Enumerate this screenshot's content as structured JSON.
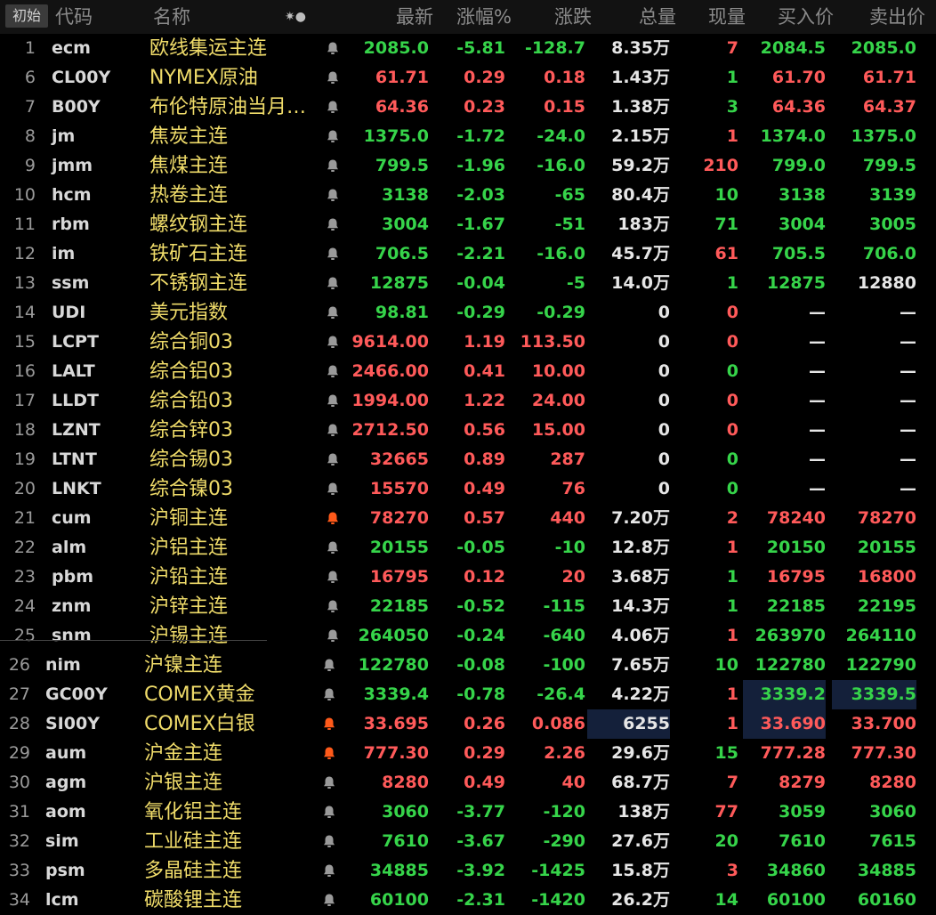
{
  "header": {
    "init_label": "初始",
    "code": "代码",
    "name": "名称",
    "settings_glyph": "✷●",
    "last": "最新",
    "pct": "涨幅%",
    "change": "涨跌",
    "volume": "总量",
    "current": "现量",
    "bid": "买入价",
    "ask": "卖出价"
  },
  "colors": {
    "up": "#ff5a5a",
    "down": "#36d44a",
    "name": "#f0dc6a",
    "bell_active": "#ff5a1a",
    "bell_inactive": "#9a9a9a",
    "highlight": "#14203a"
  },
  "rows": [
    {
      "num": "1",
      "code": "ecm",
      "name": "欧线集运主连",
      "bell": "off",
      "last": "2085.0",
      "pct": "-5.81",
      "chg": "-128.7",
      "vol": "8.35万",
      "cur": "7",
      "bid": "2084.5",
      "ask": "2085.0",
      "lc": "dn",
      "pc": "dn",
      "cc": "dn",
      "curc": "up",
      "bc": "dn",
      "ac": "dn"
    },
    {
      "num": "6",
      "code": "CL00Y",
      "name": "NYMEX原油",
      "bell": "off",
      "last": "61.71",
      "pct": "0.29",
      "chg": "0.18",
      "vol": "1.43万",
      "cur": "1",
      "bid": "61.70",
      "ask": "61.71",
      "lc": "up",
      "pc": "up",
      "cc": "up",
      "curc": "dn",
      "bc": "up",
      "ac": "up"
    },
    {
      "num": "7",
      "code": "B00Y",
      "name": "布伦特原油当月…",
      "bell": "off",
      "last": "64.36",
      "pct": "0.23",
      "chg": "0.15",
      "vol": "1.38万",
      "cur": "3",
      "bid": "64.36",
      "ask": "64.37",
      "lc": "up",
      "pc": "up",
      "cc": "up",
      "curc": "dn",
      "bc": "up",
      "ac": "up"
    },
    {
      "num": "8",
      "code": "jm",
      "name": "焦炭主连",
      "bell": "off",
      "last": "1375.0",
      "pct": "-1.72",
      "chg": "-24.0",
      "vol": "2.15万",
      "cur": "1",
      "bid": "1374.0",
      "ask": "1375.0",
      "lc": "dn",
      "pc": "dn",
      "cc": "dn",
      "curc": "up",
      "bc": "dn",
      "ac": "dn"
    },
    {
      "num": "9",
      "code": "jmm",
      "name": "焦煤主连",
      "bell": "off",
      "last": "799.5",
      "pct": "-1.96",
      "chg": "-16.0",
      "vol": "59.2万",
      "cur": "210",
      "bid": "799.0",
      "ask": "799.5",
      "lc": "dn",
      "pc": "dn",
      "cc": "dn",
      "curc": "up",
      "bc": "dn",
      "ac": "dn"
    },
    {
      "num": "10",
      "code": "hcm",
      "name": "热卷主连",
      "bell": "off",
      "last": "3138",
      "pct": "-2.03",
      "chg": "-65",
      "vol": "80.4万",
      "cur": "10",
      "bid": "3138",
      "ask": "3139",
      "lc": "dn",
      "pc": "dn",
      "cc": "dn",
      "curc": "dn",
      "bc": "dn",
      "ac": "dn"
    },
    {
      "num": "11",
      "code": "rbm",
      "name": "螺纹钢主连",
      "bell": "off",
      "last": "3004",
      "pct": "-1.67",
      "chg": "-51",
      "vol": "183万",
      "cur": "71",
      "bid": "3004",
      "ask": "3005",
      "lc": "dn",
      "pc": "dn",
      "cc": "dn",
      "curc": "dn",
      "bc": "dn",
      "ac": "dn"
    },
    {
      "num": "12",
      "code": "im",
      "name": "铁矿石主连",
      "bell": "off",
      "last": "706.5",
      "pct": "-2.21",
      "chg": "-16.0",
      "vol": "45.7万",
      "cur": "61",
      "bid": "705.5",
      "ask": "706.0",
      "lc": "dn",
      "pc": "dn",
      "cc": "dn",
      "curc": "up",
      "bc": "dn",
      "ac": "dn"
    },
    {
      "num": "13",
      "code": "ssm",
      "name": "不锈钢主连",
      "bell": "off",
      "last": "12875",
      "pct": "-0.04",
      "chg": "-5",
      "vol": "14.0万",
      "cur": "1",
      "bid": "12875",
      "ask": "12880",
      "lc": "dn",
      "pc": "dn",
      "cc": "dn",
      "curc": "dn",
      "bc": "dn",
      "ac": "nt"
    },
    {
      "num": "14",
      "code": "UDI",
      "name": "美元指数",
      "bell": "off",
      "last": "98.81",
      "pct": "-0.29",
      "chg": "-0.29",
      "vol": "0",
      "cur": "0",
      "bid": "—",
      "ask": "—",
      "lc": "dn",
      "pc": "dn",
      "cc": "dn",
      "curc": "up",
      "bc": "dash",
      "ac": "dash"
    },
    {
      "num": "15",
      "code": "LCPT",
      "name": "综合铜03",
      "bell": "off",
      "last": "9614.00",
      "pct": "1.19",
      "chg": "113.50",
      "vol": "0",
      "cur": "0",
      "bid": "—",
      "ask": "—",
      "lc": "up",
      "pc": "up",
      "cc": "up",
      "curc": "up",
      "bc": "dash",
      "ac": "dash"
    },
    {
      "num": "16",
      "code": "LALT",
      "name": "综合铝03",
      "bell": "off",
      "last": "2466.00",
      "pct": "0.41",
      "chg": "10.00",
      "vol": "0",
      "cur": "0",
      "bid": "—",
      "ask": "—",
      "lc": "up",
      "pc": "up",
      "cc": "up",
      "curc": "dn",
      "bc": "dash",
      "ac": "dash"
    },
    {
      "num": "17",
      "code": "LLDT",
      "name": "综合铅03",
      "bell": "off",
      "last": "1994.00",
      "pct": "1.22",
      "chg": "24.00",
      "vol": "0",
      "cur": "0",
      "bid": "—",
      "ask": "—",
      "lc": "up",
      "pc": "up",
      "cc": "up",
      "curc": "up",
      "bc": "dash",
      "ac": "dash"
    },
    {
      "num": "18",
      "code": "LZNT",
      "name": "综合锌03",
      "bell": "off",
      "last": "2712.50",
      "pct": "0.56",
      "chg": "15.00",
      "vol": "0",
      "cur": "0",
      "bid": "—",
      "ask": "—",
      "lc": "up",
      "pc": "up",
      "cc": "up",
      "curc": "up",
      "bc": "dash",
      "ac": "dash"
    },
    {
      "num": "19",
      "code": "LTNT",
      "name": "综合锡03",
      "bell": "off",
      "last": "32665",
      "pct": "0.89",
      "chg": "287",
      "vol": "0",
      "cur": "0",
      "bid": "—",
      "ask": "—",
      "lc": "up",
      "pc": "up",
      "cc": "up",
      "curc": "dn",
      "bc": "dash",
      "ac": "dash"
    },
    {
      "num": "20",
      "code": "LNKT",
      "name": "综合镍03",
      "bell": "off",
      "last": "15570",
      "pct": "0.49",
      "chg": "76",
      "vol": "0",
      "cur": "0",
      "bid": "—",
      "ask": "—",
      "lc": "up",
      "pc": "up",
      "cc": "up",
      "curc": "dn",
      "bc": "dash",
      "ac": "dash"
    },
    {
      "num": "21",
      "code": "cum",
      "name": "沪铜主连",
      "bell": "on",
      "last": "78270",
      "pct": "0.57",
      "chg": "440",
      "vol": "7.20万",
      "cur": "2",
      "bid": "78240",
      "ask": "78270",
      "lc": "up",
      "pc": "up",
      "cc": "up",
      "curc": "up",
      "bc": "up",
      "ac": "up"
    },
    {
      "num": "22",
      "code": "alm",
      "name": "沪铝主连",
      "bell": "off",
      "last": "20155",
      "pct": "-0.05",
      "chg": "-10",
      "vol": "12.8万",
      "cur": "1",
      "bid": "20150",
      "ask": "20155",
      "lc": "dn",
      "pc": "dn",
      "cc": "dn",
      "curc": "up",
      "bc": "dn",
      "ac": "dn"
    },
    {
      "num": "23",
      "code": "pbm",
      "name": "沪铅主连",
      "bell": "off",
      "last": "16795",
      "pct": "0.12",
      "chg": "20",
      "vol": "3.68万",
      "cur": "1",
      "bid": "16795",
      "ask": "16800",
      "lc": "up",
      "pc": "up",
      "cc": "up",
      "curc": "dn",
      "bc": "up",
      "ac": "up"
    },
    {
      "num": "24",
      "code": "znm",
      "name": "沪锌主连",
      "bell": "off",
      "last": "22185",
      "pct": "-0.52",
      "chg": "-115",
      "vol": "14.3万",
      "cur": "1",
      "bid": "22185",
      "ask": "22195",
      "lc": "dn",
      "pc": "dn",
      "cc": "dn",
      "curc": "dn",
      "bc": "dn",
      "ac": "dn"
    },
    {
      "num": "25",
      "code": "snm",
      "name": "沪锡主连",
      "bell": "off",
      "last": "264050",
      "pct": "-0.24",
      "chg": "-640",
      "vol": "4.06万",
      "cur": "1",
      "bid": "263970",
      "ask": "264110",
      "lc": "dn",
      "pc": "dn",
      "cc": "dn",
      "curc": "up",
      "bc": "dn",
      "ac": "dn"
    },
    {
      "num": "26",
      "code": "nim",
      "name": "沪镍主连",
      "bell": "off",
      "last": "122780",
      "pct": "-0.08",
      "chg": "-100",
      "vol": "7.65万",
      "cur": "10",
      "bid": "122780",
      "ask": "122790",
      "lc": "dn",
      "pc": "dn",
      "cc": "dn",
      "curc": "dn",
      "bc": "dn",
      "ac": "dn"
    },
    {
      "num": "27",
      "code": "GC00Y",
      "name": "COMEX黄金",
      "bell": "off",
      "last": "3339.4",
      "pct": "-0.78",
      "chg": "-26.4",
      "vol": "4.22万",
      "cur": "1",
      "bid": "3339.2",
      "ask": "3339.5",
      "lc": "dn",
      "pc": "dn",
      "cc": "dn",
      "curc": "up",
      "bc": "dn",
      "ac": "dn"
    },
    {
      "num": "28",
      "code": "SI00Y",
      "name": "COMEX白银",
      "bell": "on",
      "last": "33.695",
      "pct": "0.26",
      "chg": "0.086",
      "vol": "6255",
      "cur": "1",
      "bid": "33.690",
      "ask": "33.700",
      "lc": "up",
      "pc": "up",
      "cc": "up",
      "curc": "up",
      "bc": "up",
      "ac": "up"
    },
    {
      "num": "29",
      "code": "aum",
      "name": "沪金主连",
      "bell": "on",
      "last": "777.30",
      "pct": "0.29",
      "chg": "2.26",
      "vol": "29.6万",
      "cur": "15",
      "bid": "777.28",
      "ask": "777.30",
      "lc": "up",
      "pc": "up",
      "cc": "up",
      "curc": "dn",
      "bc": "up",
      "ac": "up"
    },
    {
      "num": "30",
      "code": "agm",
      "name": "沪银主连",
      "bell": "off",
      "last": "8280",
      "pct": "0.49",
      "chg": "40",
      "vol": "68.7万",
      "cur": "7",
      "bid": "8279",
      "ask": "8280",
      "lc": "up",
      "pc": "up",
      "cc": "up",
      "curc": "up",
      "bc": "up",
      "ac": "up"
    },
    {
      "num": "31",
      "code": "aom",
      "name": "氧化铝主连",
      "bell": "off",
      "last": "3060",
      "pct": "-3.77",
      "chg": "-120",
      "vol": "138万",
      "cur": "77",
      "bid": "3059",
      "ask": "3060",
      "lc": "dn",
      "pc": "dn",
      "cc": "dn",
      "curc": "up",
      "bc": "dn",
      "ac": "dn"
    },
    {
      "num": "32",
      "code": "sim",
      "name": "工业硅主连",
      "bell": "off",
      "last": "7610",
      "pct": "-3.67",
      "chg": "-290",
      "vol": "27.6万",
      "cur": "20",
      "bid": "7610",
      "ask": "7615",
      "lc": "dn",
      "pc": "dn",
      "cc": "dn",
      "curc": "dn",
      "bc": "dn",
      "ac": "dn"
    },
    {
      "num": "33",
      "code": "psm",
      "name": "多晶硅主连",
      "bell": "off",
      "last": "34885",
      "pct": "-3.92",
      "chg": "-1425",
      "vol": "15.8万",
      "cur": "3",
      "bid": "34860",
      "ask": "34885",
      "lc": "dn",
      "pc": "dn",
      "cc": "dn",
      "curc": "up",
      "bc": "dn",
      "ac": "dn"
    },
    {
      "num": "34",
      "code": "lcm",
      "name": "碳酸锂主连",
      "bell": "off",
      "last": "60100",
      "pct": "-2.31",
      "chg": "-1420",
      "vol": "26.2万",
      "cur": "14",
      "bid": "60100",
      "ask": "60160",
      "lc": "dn",
      "pc": "dn",
      "cc": "dn",
      "curc": "dn",
      "bc": "dn",
      "ac": "dn"
    }
  ]
}
